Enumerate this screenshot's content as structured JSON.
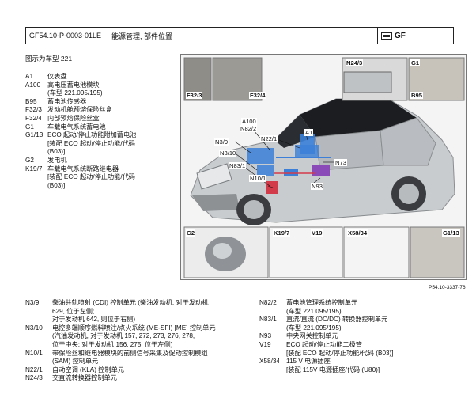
{
  "header": {
    "doc_id": "GF54.10-P-0003-01LE",
    "title": "能源管理, 部件位置",
    "tag": "GF"
  },
  "caption": "图示为车型 221",
  "legend": [
    {
      "code": "A1",
      "desc": "仪表盘"
    },
    {
      "code": "A100",
      "desc": "高电压蓄电池模块\n(车型 221.095/195)"
    },
    {
      "code": "B95",
      "desc": "蓄电池传感器"
    },
    {
      "code": "F32/3",
      "desc": "发动机舱预熔保险丝盒"
    },
    {
      "code": "F32/4",
      "desc": "内部预熔保险丝盒"
    },
    {
      "code": "G1",
      "desc": "车载电气系统蓄电池"
    },
    {
      "code": "G1/13",
      "desc": "ECO 起动/停止功能附加蓄电池\n[装配 ECO 起动/停止功能/代码\n(B03)]"
    },
    {
      "code": "G2",
      "desc": "发电机"
    },
    {
      "code": "K19/7",
      "desc": "车载电气系统断路继电器\n[装配 ECO 起动/停止功能/代码\n(B03)]"
    }
  ],
  "diagram_labels": {
    "f32_3": "F32/3",
    "f32_4": "F32/4",
    "n24_3": "N24/3",
    "g1": "G1",
    "b95": "B95",
    "a100": "A100",
    "n82_2": "N82/2",
    "a1": "A1",
    "n3_9": "N3/9",
    "n22_1": "N22/1",
    "n3_10": "N3/10",
    "n83_1": "N83/1",
    "n73": "N73",
    "n10_1": "N10/1",
    "n93": "N93",
    "g2": "G2",
    "k19_7": "K19/7",
    "v19": "V19",
    "x58_34": "X58/34",
    "g1_13": "G1/13"
  },
  "figure_ref": "P54.10-3337-76",
  "list_left": [
    {
      "code": "N3/9",
      "desc": "柴油共轨喷射 (CDI) 控制单元 (柴油发动机, 对于发动机\n629, 位于左侧;\n对于发动机 642, 则位于右侧)"
    },
    {
      "code": "N3/10",
      "desc": "电控多端顺序燃料喷注/点火系统 (ME-SFI) [ME] 控制单元\n(汽油发动机, 对于发动机 157, 272, 273, 276, 278,\n位于中央; 对于发动机 156, 275, 位于左侧)"
    },
    {
      "code": "N10/1",
      "desc": "带保险丝和继电器模块的前侧信号采集及促动控制模组\n(SAM) 控制单元"
    },
    {
      "code": "N22/1",
      "desc": "自动空调 (KLA) 控制单元"
    },
    {
      "code": "N24/3",
      "desc": "交直流转换器控制单元"
    }
  ],
  "list_right": [
    {
      "code": "N82/2",
      "desc": "蓄电池管理系统控制单元\n(车型 221.095/195)"
    },
    {
      "code": "N83/1",
      "desc": "直流/直流 (DC/DC) 转换器控制单元\n(车型 221.095/195)"
    },
    {
      "code": "N93",
      "desc": "中央网关控制单元"
    },
    {
      "code": "V19",
      "desc": "ECO 起动/停止功能二极管\n[装配 ECO 起动/停止功能/代码 (B03)]"
    },
    {
      "code": "X58/34",
      "desc": "115 V 电源插座\n[装配 115V 电源插座/代码 (U80)]"
    }
  ],
  "colors": {
    "component_blue": "#3b7fd8",
    "component_purple": "#8a4ab8",
    "component_red": "#d23b4a",
    "car_body": "#c9cccf"
  }
}
